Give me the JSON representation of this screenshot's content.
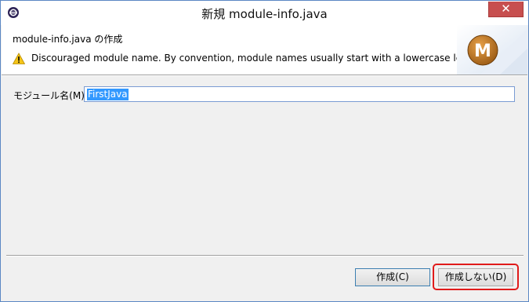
{
  "window": {
    "title": "新規 module-info.java",
    "close_glyph": "✕"
  },
  "banner": {
    "title": "module-info.java の作成",
    "warning_icon": "warning-triangle-icon",
    "warning_message": "Discouraged module name. By convention, module names usually start with a lowercase letter",
    "graphic_letter": "M"
  },
  "form": {
    "module_name_label": "モジュール名(M):",
    "module_name_value": "FirstJava"
  },
  "buttons": {
    "finish_label": "作成(C)",
    "dont_create_label": "作成しない(D)"
  },
  "colors": {
    "accent": "#3399ff",
    "highlight": "#e01b1b",
    "close_button": "#c74f4f"
  }
}
